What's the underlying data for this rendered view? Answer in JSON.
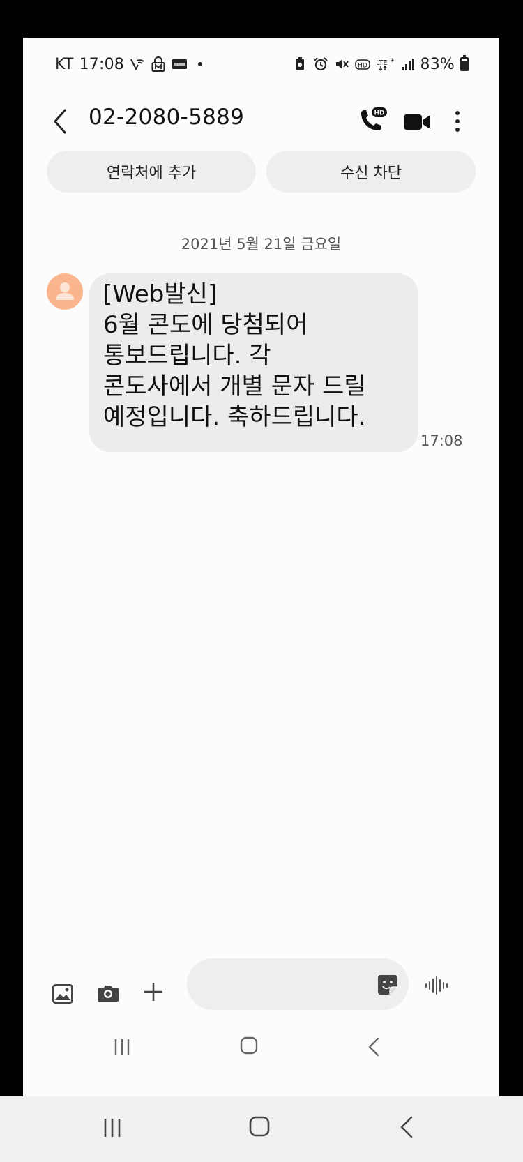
{
  "status_bar": {
    "carrier": "KT",
    "time": "17:08",
    "battery": "83%",
    "left_icons": [
      "vowifi-icon",
      "m-lock-icon",
      "pass-icon",
      "dot"
    ],
    "right_icons": [
      "battery-saver-icon",
      "alarm-icon",
      "mute-icon",
      "hd-icon",
      "lte-icon",
      "signal-icon"
    ]
  },
  "header": {
    "title": "02-2080-5889",
    "hd_badge": "HD"
  },
  "actions": {
    "add_contact": "연락처에 추가",
    "block": "수신 차단"
  },
  "conversation": {
    "date": "2021년 5월 21일 금요일",
    "messages": [
      {
        "lines": [
          "[Web발신]",
          "6월 콘도에 당첨되어",
          "통보드립니다. 각",
          "콘도사에서 개별 문자 드릴",
          "예정입니다. 축하드립니다."
        ],
        "time": "17:08"
      }
    ]
  },
  "composer": {
    "placeholder": ""
  },
  "colors": {
    "screen_bg": "#fcfcfc",
    "bubble_bg": "#ececec",
    "pill_bg": "#eeeeee",
    "avatar": "#fbb58e",
    "text": "#111111",
    "muted_text": "#555555"
  }
}
